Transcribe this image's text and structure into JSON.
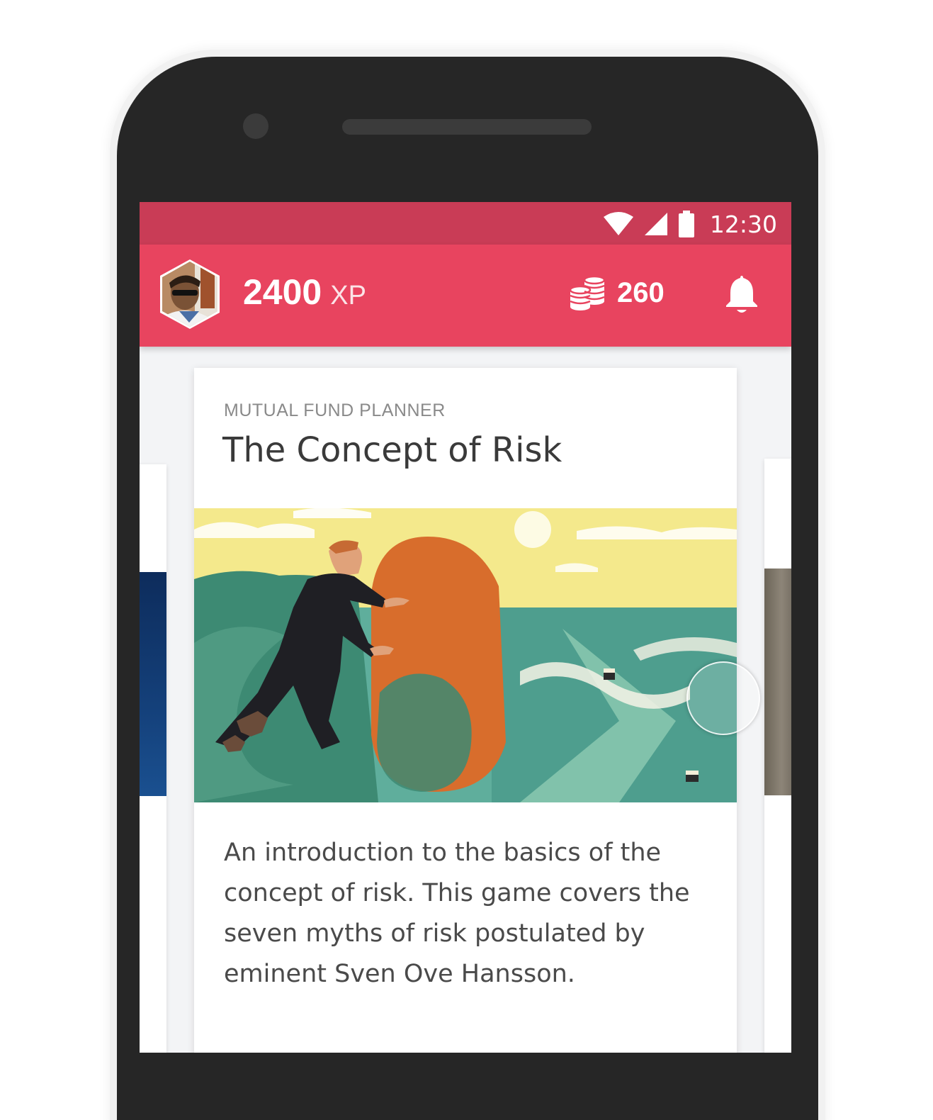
{
  "status_bar": {
    "time": "12:30",
    "icons": [
      "wifi-icon",
      "cellular-signal-icon",
      "battery-icon"
    ],
    "background": "#c93c56"
  },
  "app_bar": {
    "background": "#e8445f",
    "xp_value": "2400",
    "xp_unit": "XP",
    "coins_value": "260",
    "icons": [
      "avatar",
      "coins-icon",
      "bell-icon"
    ]
  },
  "card": {
    "category": "MUTUAL FUND PLANNER",
    "title": "The Concept of Risk",
    "description": "An introduction to the basics of the concept of risk. This game covers the seven myths of risk postulated by eminent Sven Ove Hansson."
  }
}
